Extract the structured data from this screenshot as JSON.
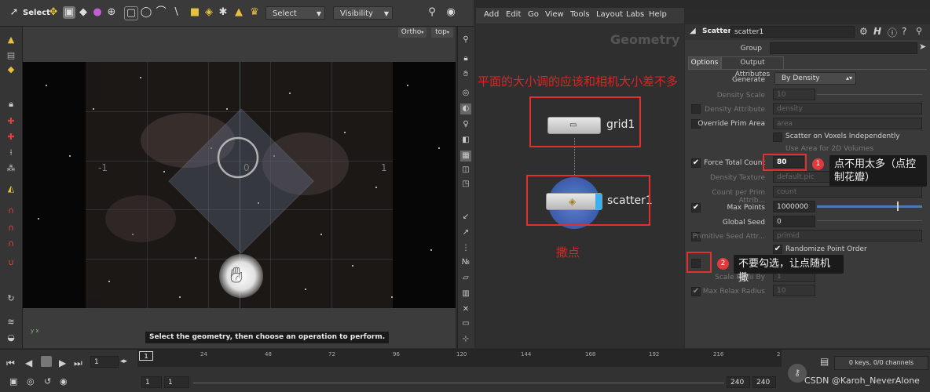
{
  "viewport_toolbar": {
    "select_label": "Select",
    "select_mode": "Select",
    "visibility": "Visibility"
  },
  "viewport": {
    "camera": "Ortho",
    "view": "top",
    "status_message": "Select the geometry, then choose an operation to perform.",
    "grid_labels": [
      "-1",
      "0",
      "1"
    ]
  },
  "network": {
    "menu": [
      "Add",
      "Edit",
      "Go",
      "View",
      "Tools",
      "Layout",
      "Labs",
      "Help"
    ],
    "context_label": "Geometry",
    "nodes": [
      {
        "name": "grid1"
      },
      {
        "name": "scatter1"
      }
    ]
  },
  "annotations": {
    "plane_note": "平面的大小调的应该和相机大小差不多",
    "scatter_note": "撒点",
    "badge1": "1",
    "callout1": "点不用太多（点控制花瓣）",
    "badge2": "2",
    "callout2": "不要勾选，让点随机撒"
  },
  "parameters": {
    "node_type": "Scatter",
    "node_name": "scatter1",
    "group_label": "Group",
    "group_value": "",
    "tabs": [
      "Options",
      "Output Attributes"
    ],
    "generate_label": "Generate",
    "generate_value": "By Density",
    "density_scale_label": "Density Scale",
    "density_scale_value": "10",
    "density_attribute_label": "Density Attribute",
    "density_attribute_value": "density",
    "override_prim_area_label": "Override Prim Area",
    "override_prim_area_value": "area",
    "scatter_voxels_label": "Scatter on Voxels Independently",
    "use_area_label": "Use Area for 2D Volumes",
    "force_total_count_label": "Force Total Count",
    "force_total_count_value": "80",
    "density_texture_label": "Density Texture",
    "density_texture_value": "default.pic",
    "count_per_prim_label": "Count per Prim Attrib...",
    "count_per_prim_value": "count",
    "max_points_label": "Max Points",
    "max_points_value": "1000000",
    "global_seed_label": "Global Seed",
    "global_seed_value": "0",
    "primitive_seed_label": "Primitive Seed Attr...",
    "primitive_seed_value": "primid",
    "randomize_label": "Randomize Point Order",
    "scale_radii_label": "Scale Radii By",
    "scale_radii_value": "1",
    "max_relax_label": "Max Relax Radius",
    "max_relax_value": "10"
  },
  "timeline": {
    "current_frame": "1",
    "ticks": [
      "1",
      "24",
      "48",
      "72",
      "96",
      "120",
      "144",
      "168",
      "192",
      "216",
      "2"
    ],
    "start": "1",
    "start2": "1",
    "end": "240",
    "end2": "240",
    "keys_label": "0 keys, 0/0 channels"
  },
  "watermark": "CSDN @Karoh_NeverAlone"
}
